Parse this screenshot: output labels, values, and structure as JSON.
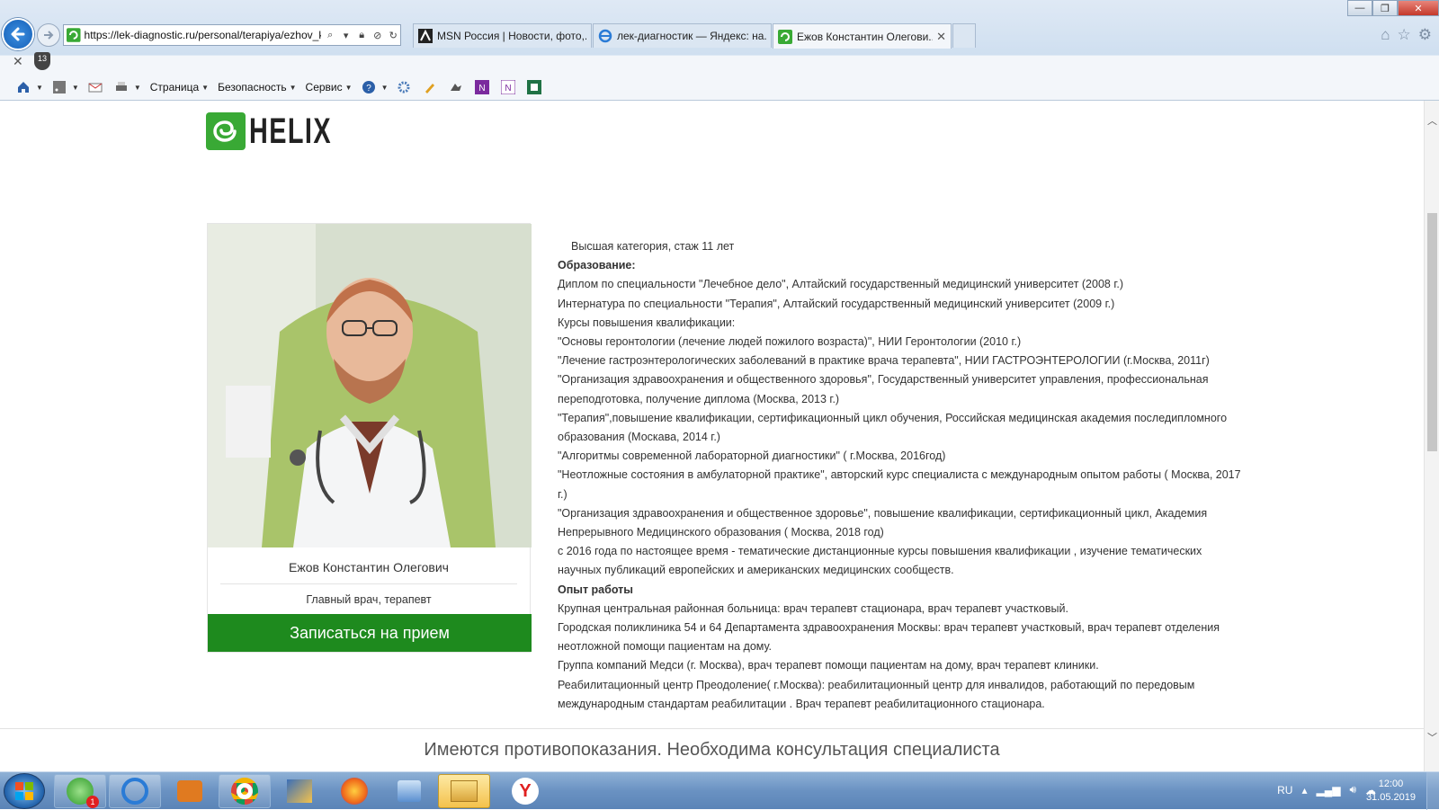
{
  "browser": {
    "address_url": "https://lek-diagnostic.ru/personal/terapiya/ezhov_k",
    "tabs": [
      {
        "label": "MSN Россия | Новости, фото,...",
        "active": false
      },
      {
        "label": "лек-диагностик — Яндекс: на...",
        "active": false
      },
      {
        "label": "Ежов Константин Олегови...",
        "active": true
      }
    ],
    "tracking_badge": "13",
    "command_bar": {
      "page_label": "Страница",
      "safety_label": "Безопасность",
      "service_label": "Сервис"
    }
  },
  "page": {
    "logo_text": "HELIX",
    "doctor": {
      "name": "Ежов Константин Олегович",
      "position": "Главный врач, терапевт",
      "book_button": "Записаться на прием"
    },
    "bio": {
      "category": "Высшая категория, стаж 11 лет",
      "education_heading": "Образование:",
      "education": [
        "Диплом по специальности \"Лечебное дело\", Алтайский государственный медицинский университет (2008 г.)",
        "Интернатура по специальности \"Терапия\", Алтайский государственный медицинский университет (2009 г.)",
        "Курсы повышения квалификации:",
        "\"Основы геронтологии (лечение людей пожилого возраста)\", НИИ Геронтологии (2010 г.)",
        "\"Лечение гастроэнтерологических заболеваний в практике врача терапевта\", НИИ ГАСТРОЭНТЕРОЛОГИИ (г.Москва, 2011г)",
        "\"Организация здравоохранения и общественного здоровья\", Государственный университет управления, профессиональная переподготовка, получение диплома (Москва, 2013 г.)",
        "\"Терапия\",повышение квалификации, сертификационный цикл обучения, Российская медицинская академия последипломного образования (Москава, 2014 г.)",
        "\"Алгоритмы современной лабораторной диагностики\" ( г.Москва, 2016год)",
        "\"Неотложные состояния в амбулаторной практике\", авторский курс специалиста с международным опытом работы ( Москва, 2017 г.)",
        "\"Организация здравоохранения и общественное здоровье\", повышение квалификации, сертификационный цикл, Академия Непрерывного Медицинского образования ( Москва, 2018 год)",
        "с 2016 года по настоящее время - тематические дистанционные курсы повышения квалификации , изучение тематических научных публикаций европейских и американских медицинских сообществ."
      ],
      "experience_heading": "Опыт работы",
      "experience": [
        "Крупная центральная районная больница: врач терапевт стационара, врач терапевт участковый.",
        "Городская поликлиника 54 и 64 Департамента здравоохранения Москвы: врач терапевт участковый, врач терапевт отделения неотложной помощи пациентам на дому.",
        "Группа компаний Медси (г. Москва), врач терапевт помощи пациентам на дому, врач терапевт клиники.",
        "Реабилитационный центр Преодоление( г.Москва): реабилитационный центр для инвалидов, работающий по передовым международным стандартам реабилитации . Врач терапевт реабилитационного стационара."
      ]
    },
    "warning": "Имеются противопоказания. Необходима консультация специалиста"
  },
  "taskbar": {
    "lang": "RU",
    "time": "12:00",
    "date": "31.05.2019",
    "badge_count": "1"
  },
  "colors": {
    "brand_green": "#39a935",
    "button_green": "#1e8a1e"
  }
}
